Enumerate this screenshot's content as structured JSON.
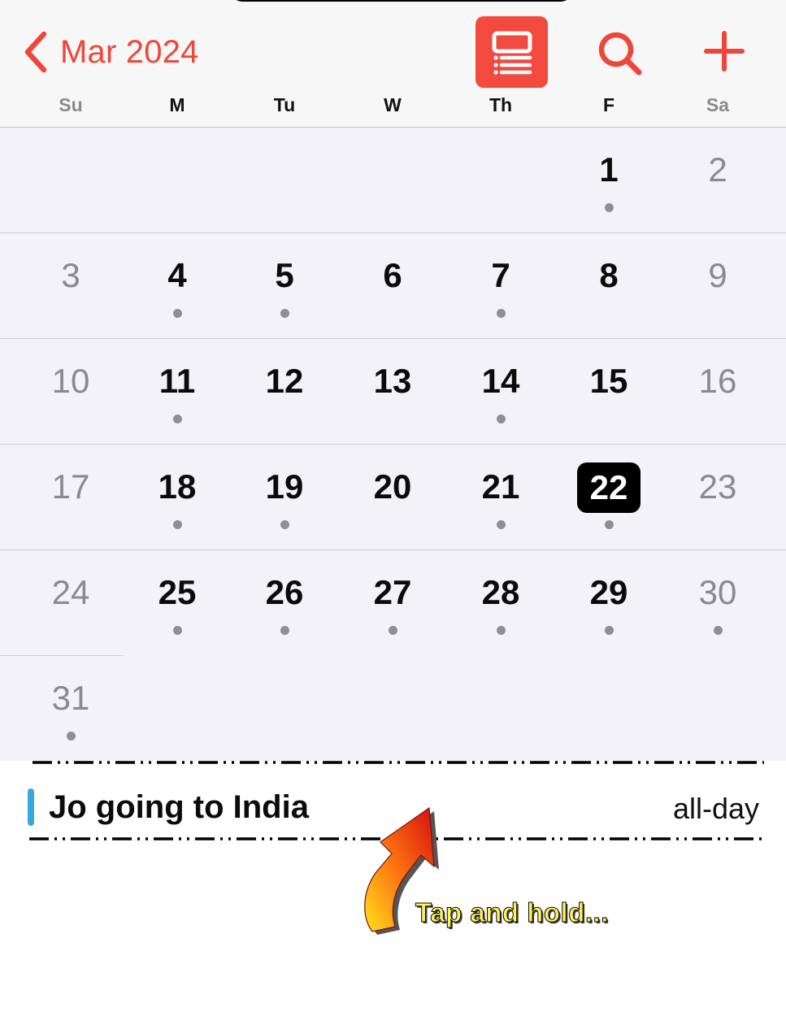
{
  "header": {
    "month_label": "Mar 2024",
    "back_icon": "chevron-left-icon",
    "list_toggle_icon": "calendar-list-icon",
    "search_icon": "search-icon",
    "add_icon": "plus-icon",
    "accent_color": "#f0453a"
  },
  "weekdays": [
    "Su",
    "M",
    "Tu",
    "W",
    "Th",
    "F",
    "Sa"
  ],
  "month": {
    "weeks": [
      [
        {
          "day": "",
          "dot": false
        },
        {
          "day": "",
          "dot": false
        },
        {
          "day": "",
          "dot": false
        },
        {
          "day": "",
          "dot": false
        },
        {
          "day": "",
          "dot": false
        },
        {
          "day": "1",
          "dot": true
        },
        {
          "day": "2",
          "dot": false
        }
      ],
      [
        {
          "day": "3",
          "dot": false
        },
        {
          "day": "4",
          "dot": true
        },
        {
          "day": "5",
          "dot": true
        },
        {
          "day": "6",
          "dot": false
        },
        {
          "day": "7",
          "dot": true
        },
        {
          "day": "8",
          "dot": false
        },
        {
          "day": "9",
          "dot": false
        }
      ],
      [
        {
          "day": "10",
          "dot": false
        },
        {
          "day": "11",
          "dot": true
        },
        {
          "day": "12",
          "dot": false
        },
        {
          "day": "13",
          "dot": false
        },
        {
          "day": "14",
          "dot": true
        },
        {
          "day": "15",
          "dot": false
        },
        {
          "day": "16",
          "dot": false
        }
      ],
      [
        {
          "day": "17",
          "dot": false
        },
        {
          "day": "18",
          "dot": true
        },
        {
          "day": "19",
          "dot": true
        },
        {
          "day": "20",
          "dot": false
        },
        {
          "day": "21",
          "dot": true
        },
        {
          "day": "22",
          "dot": true,
          "today": true
        },
        {
          "day": "23",
          "dot": false
        }
      ],
      [
        {
          "day": "24",
          "dot": false
        },
        {
          "day": "25",
          "dot": true
        },
        {
          "day": "26",
          "dot": true
        },
        {
          "day": "27",
          "dot": true
        },
        {
          "day": "28",
          "dot": true
        },
        {
          "day": "29",
          "dot": true
        },
        {
          "day": "30",
          "dot": true
        }
      ],
      [
        {
          "day": "31",
          "dot": true
        },
        {
          "day": "",
          "dot": false
        },
        {
          "day": "",
          "dot": false
        },
        {
          "day": "",
          "dot": false
        },
        {
          "day": "",
          "dot": false
        },
        {
          "day": "",
          "dot": false
        },
        {
          "day": "",
          "dot": false
        }
      ]
    ]
  },
  "event": {
    "title": "Jo going to India",
    "time": "all-day",
    "calendar_color": "#35a8de"
  },
  "annotation": {
    "text": "Tap and hold...",
    "icon": "curved-arrow-icon"
  }
}
